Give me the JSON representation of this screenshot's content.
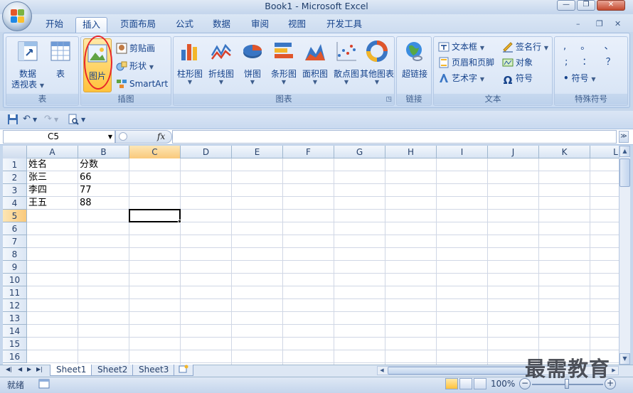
{
  "window": {
    "title": "Book1 - Microsoft Excel",
    "minimize": "—",
    "restore": "❐",
    "close": "✕"
  },
  "tabs": [
    "开始",
    "插入",
    "页面布局",
    "公式",
    "数据",
    "审阅",
    "视图",
    "开发工具"
  ],
  "active_tab": "插入",
  "mdi_controls": {
    "minimize": "–",
    "restore": "❐",
    "close": "✕"
  },
  "ribbon": {
    "tables": {
      "label": "表",
      "pivot_line1": "数据",
      "pivot_line2": "透视表",
      "table": "表"
    },
    "illustrations": {
      "label": "插图",
      "picture": "图片",
      "clipart": "剪贴画",
      "shapes": "形状",
      "smartart": "SmartArt"
    },
    "charts": {
      "label": "图表",
      "items": [
        "柱形图",
        "折线图",
        "饼图",
        "条形图",
        "面积图",
        "散点图",
        "其他图表"
      ]
    },
    "links": {
      "label": "链接",
      "hyperlink": "超链接"
    },
    "text": {
      "label": "文本",
      "textbox": "文本框",
      "header_footer": "页眉和页脚",
      "wordart": "艺术字",
      "signature": "签名行",
      "object": "对象",
      "symbol": "符号"
    },
    "special": {
      "label": "特殊符号",
      "row1": [
        ",",
        "。",
        "、"
      ],
      "row2": [
        ";",
        "：",
        "？"
      ],
      "symbol": "符号"
    }
  },
  "formula_bar": {
    "name_box": "C5",
    "fx": "fx",
    "formula": ""
  },
  "grid": {
    "columns": [
      "A",
      "B",
      "C",
      "D",
      "E",
      "F",
      "G",
      "H",
      "I",
      "J",
      "K",
      "L"
    ],
    "rows": [
      "1",
      "2",
      "3",
      "4",
      "5",
      "6",
      "7",
      "8",
      "9",
      "10",
      "11",
      "12",
      "13",
      "14",
      "15",
      "16"
    ],
    "selected_column": "C",
    "selected_row": "5",
    "cells": [
      {
        "ref": "A1",
        "value": "姓名"
      },
      {
        "ref": "B1",
        "value": "分数"
      },
      {
        "ref": "A2",
        "value": "张三"
      },
      {
        "ref": "B2",
        "value": "66"
      },
      {
        "ref": "A3",
        "value": "李四"
      },
      {
        "ref": "B3",
        "value": "77"
      },
      {
        "ref": "A4",
        "value": "王五"
      },
      {
        "ref": "B4",
        "value": "88"
      }
    ]
  },
  "sheets": [
    "Sheet1",
    "Sheet2",
    "Sheet3"
  ],
  "active_sheet": "Sheet1",
  "status": {
    "ready": "就绪",
    "zoom": "100%",
    "zoom_out": "−",
    "zoom_in": "+"
  },
  "watermark": "最需教育"
}
